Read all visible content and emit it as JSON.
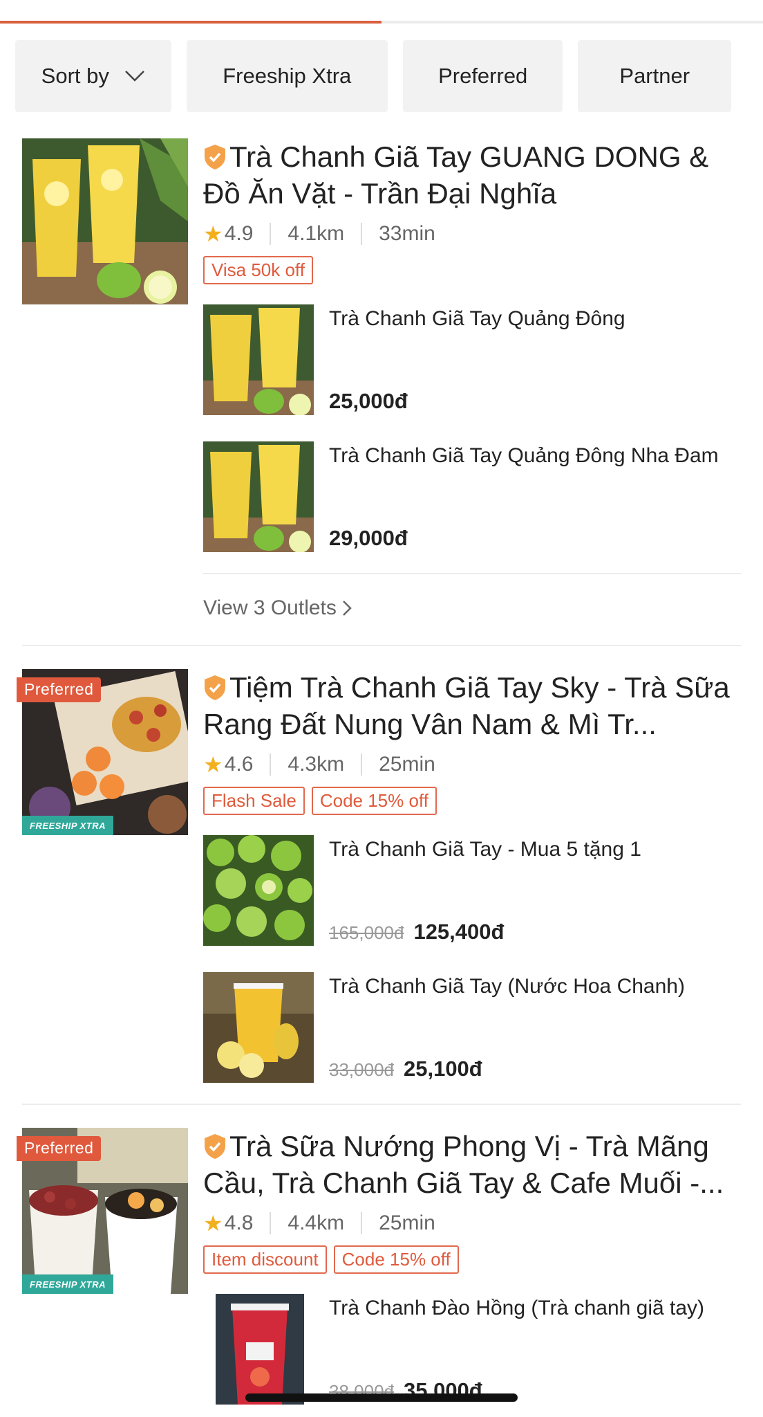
{
  "progress": {
    "fraction": 0.5,
    "color": "#d9603f"
  },
  "filters": {
    "sort_label": "Sort by",
    "freeship_label": "Freeship Xtra",
    "preferred_label": "Preferred",
    "partner_label": "Partner"
  },
  "restaurants": [
    {
      "title": "Trà Chanh Giã Tay GUANG DONG & Đồ Ăn Vặt - Trần Đại Nghĩa",
      "rating": "4.9",
      "distance": "4.1km",
      "time": "33min",
      "tags": [
        "Visa 50k off"
      ],
      "dishes": [
        {
          "name": "Trà Chanh Giã Tay Quảng Đông",
          "price": "25,000đ"
        },
        {
          "name": "Trà Chanh Giã Tay Quảng Đông Nha Đam",
          "price": "29,000đ"
        }
      ],
      "outlets_label": "View 3 Outlets"
    },
    {
      "badge": "Preferred",
      "freeship_badge": "FREESHIP XTRA",
      "title": "Tiệm Trà Chanh Giã Tay Sky - Trà Sữa Rang Đất Nung Vân Nam & Mì Tr...",
      "rating": "4.6",
      "distance": "4.3km",
      "time": "25min",
      "tags": [
        "Flash Sale",
        "Code 15% off"
      ],
      "dishes": [
        {
          "name": "Trà Chanh Giã Tay - Mua 5 tặng 1",
          "old_price": "165,000đ",
          "price": "125,400đ"
        },
        {
          "name": "Trà Chanh Giã Tay (Nước Hoa Chanh)",
          "old_price": "33,000đ",
          "price": "25,100đ"
        }
      ]
    },
    {
      "badge": "Preferred",
      "freeship_badge": "FREESHIP XTRA",
      "title": "Trà Sữa Nướng Phong Vị - Trà Mãng Cầu, Trà Chanh Giã Tay & Cafe Muối -...",
      "rating": "4.8",
      "distance": "4.4km",
      "time": "25min",
      "tags": [
        "Item discount",
        "Code 15% off"
      ],
      "dishes": [
        {
          "name": "Trà Chanh Đào Hồng (Trà chanh giã tay)",
          "old_price": "38,000đ",
          "price": "35,000đ"
        }
      ]
    }
  ]
}
